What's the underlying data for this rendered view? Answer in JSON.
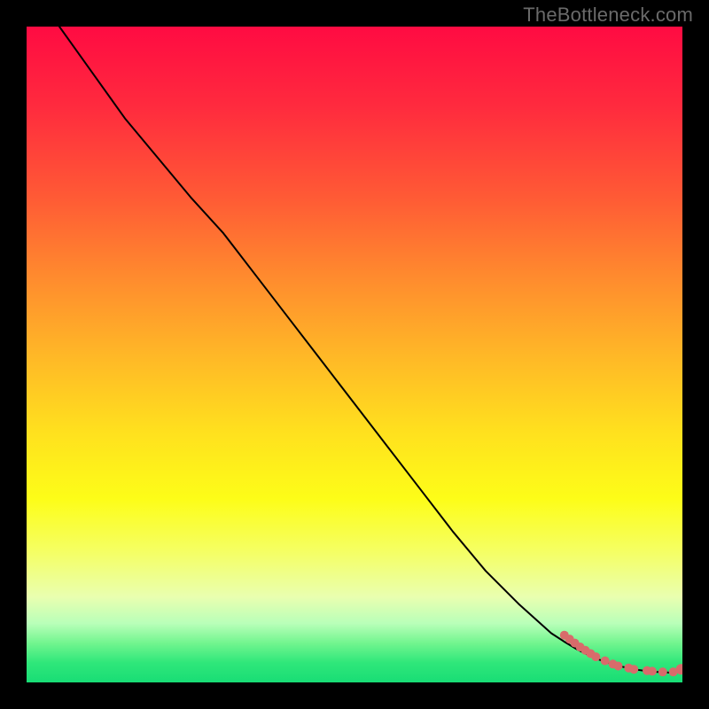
{
  "watermark": "TheBottleneck.com",
  "chart_data": {
    "type": "line",
    "title": "",
    "xlabel": "",
    "ylabel": "",
    "xlim": [
      0,
      100
    ],
    "ylim": [
      0,
      100
    ],
    "grid": false,
    "legend": false,
    "series": [
      {
        "name": "curve",
        "color": "#000000",
        "x": [
          5,
          10,
          15,
          20,
          25,
          30,
          35,
          40,
          45,
          50,
          55,
          60,
          65,
          70,
          75,
          80,
          82,
          84,
          86,
          88,
          90,
          92,
          94,
          96,
          98,
          100
        ],
        "y": [
          100,
          93,
          86,
          80,
          74,
          68.5,
          62,
          55.5,
          49,
          42.5,
          36,
          29.5,
          23,
          17,
          12,
          7.5,
          6.2,
          5.0,
          4.0,
          3.2,
          2.6,
          2.1,
          1.8,
          1.6,
          1.5,
          1.7
        ]
      },
      {
        "name": "points",
        "type": "scatter",
        "color": "#d86b6b",
        "x": [
          82.0,
          82.8,
          83.6,
          84.4,
          85.2,
          86.0,
          86.8,
          88.2,
          89.4,
          90.2,
          91.8,
          92.6,
          94.6,
          95.4,
          97.0,
          98.6,
          99.8
        ],
        "y": [
          7.2,
          6.6,
          6.0,
          5.4,
          4.9,
          4.4,
          3.9,
          3.3,
          2.8,
          2.5,
          2.2,
          2.0,
          1.8,
          1.7,
          1.6,
          1.6,
          2.0
        ],
        "size": [
          5,
          5,
          5,
          5,
          5,
          5,
          5,
          5,
          5,
          5,
          5,
          5,
          5,
          5,
          5,
          5,
          6
        ]
      }
    ]
  }
}
